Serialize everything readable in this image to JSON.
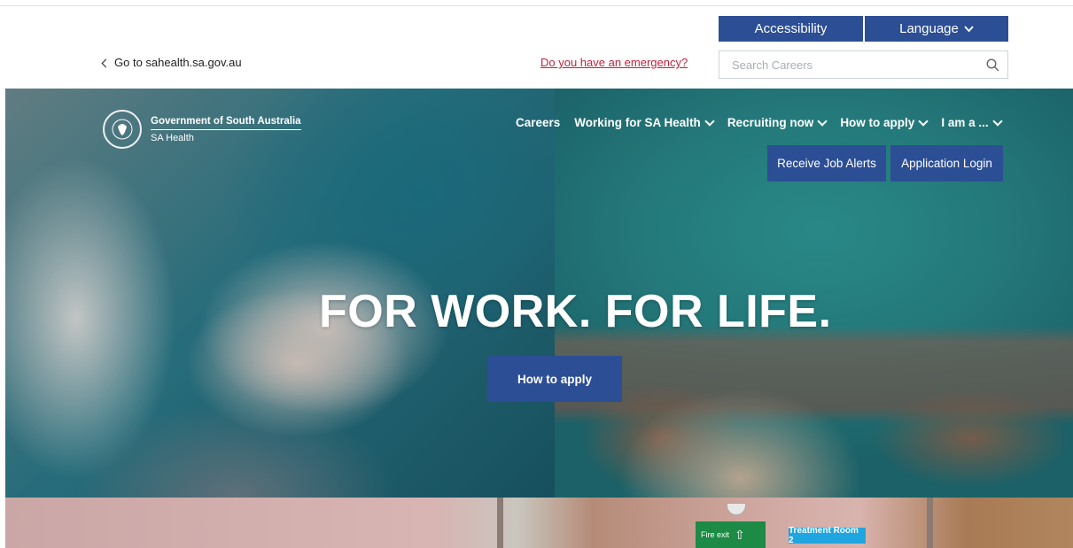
{
  "utility": {
    "accessibility_label": "Accessibility",
    "language_label": "Language"
  },
  "header": {
    "back_link": "Go to sahealth.sa.gov.au",
    "emergency_link": "Do you have an emergency?",
    "search_placeholder": "Search Careers"
  },
  "brand": {
    "line1": "Government of South Australia",
    "line2": "SA Health"
  },
  "nav": {
    "items": [
      {
        "label": "Careers"
      },
      {
        "label": "Working for SA Health"
      },
      {
        "label": "Recruiting now"
      },
      {
        "label": "How to apply"
      },
      {
        "label": "I am a ..."
      }
    ]
  },
  "hero": {
    "job_alerts_label": "Receive Job Alerts",
    "application_login_label": "Application Login",
    "headline": "FOR WORK. FOR LIFE.",
    "cta_label": "How to apply"
  },
  "strip": {
    "exit_sign": "Fire exit",
    "room_sign": "Treatment Room 2"
  },
  "colors": {
    "brand_blue": "#2c4e94",
    "emergency_red": "#c3223c"
  }
}
